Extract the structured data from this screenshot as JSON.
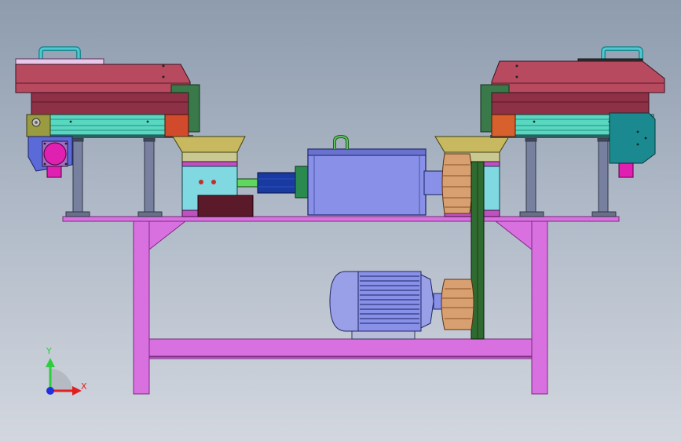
{
  "viewport": {
    "triad": {
      "y_label": "Y",
      "x_label": "X",
      "y_color": "#2ecc40",
      "x_color": "#e02020",
      "origin_color": "#2030e0"
    }
  },
  "colors": {
    "frame": "#d870e0",
    "frame_edge": "#7a2a80",
    "hopper_body": "#b84a60",
    "hopper_dark": "#7a2a3c",
    "rail": "#58d8c0",
    "motor": "#8890e8",
    "belt": "#2f6a30",
    "pulley": "#d8a070",
    "teal_box": "#1a8a90",
    "handle": "#40b8c0"
  },
  "icons": [
    "lifting-eye-icon",
    "coordinate-triad-icon"
  ]
}
